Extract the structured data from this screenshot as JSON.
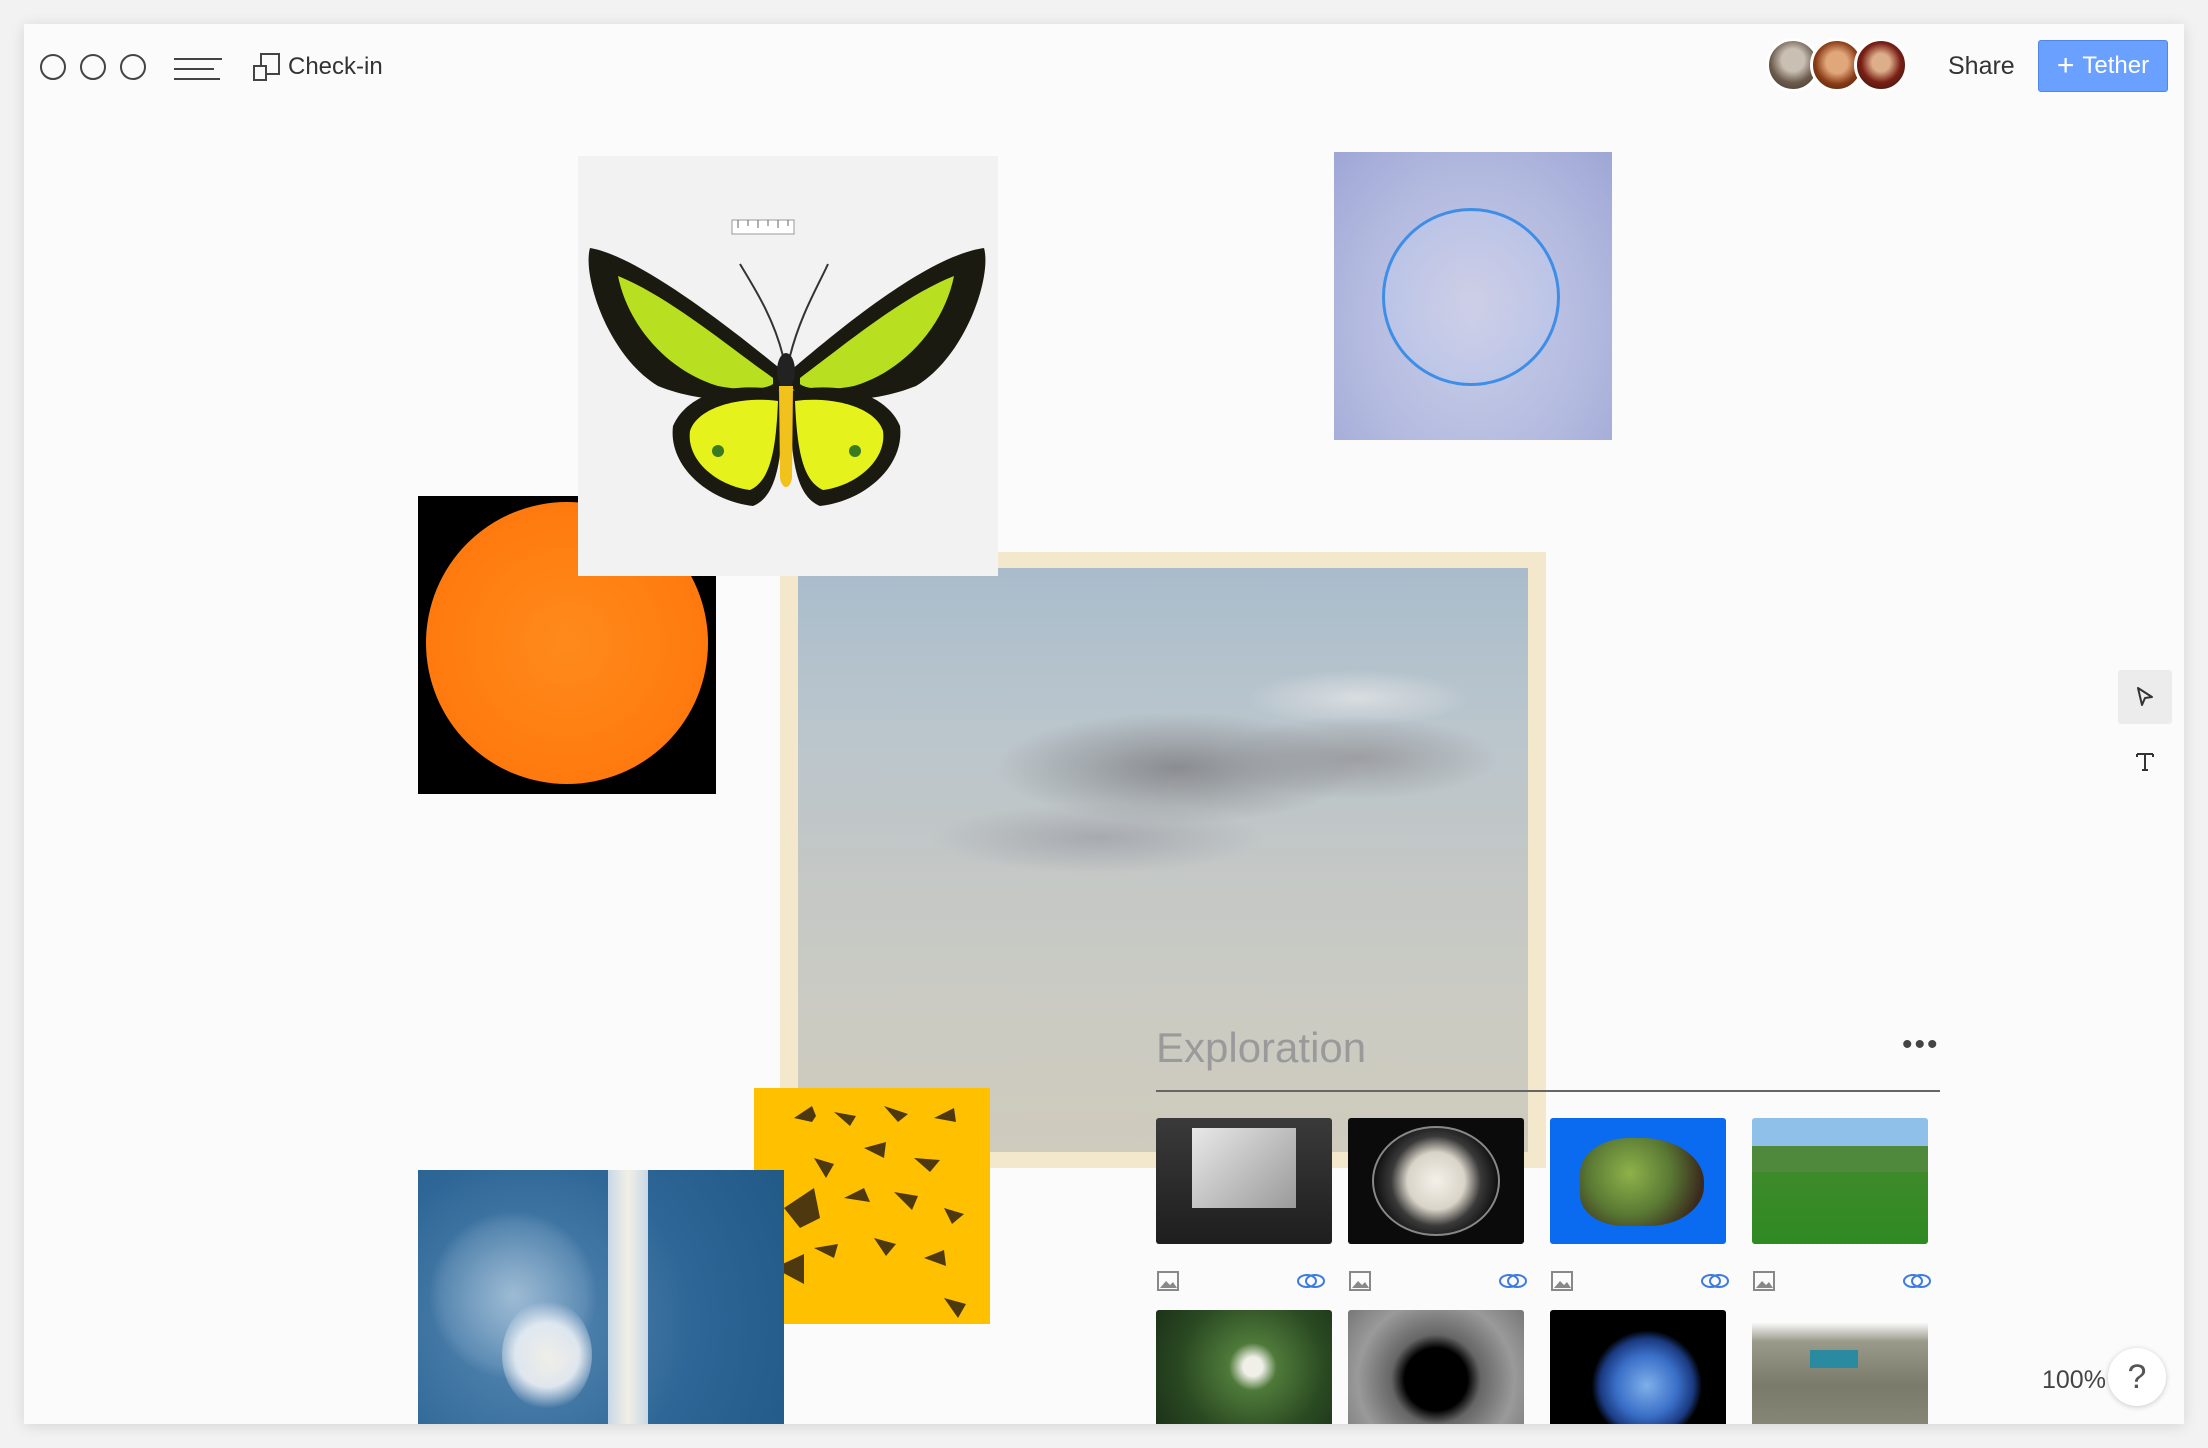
{
  "toolbar": {
    "doc_title": "Check-in",
    "share_label": "Share",
    "tether_label": "Tether",
    "tether_icon": "+",
    "accent_color": "#6aa0ff"
  },
  "board": {
    "images": [
      {
        "name": "butterfly-image",
        "label": "butterfly specimen"
      },
      {
        "name": "bubble-image",
        "label": "soap bubble"
      },
      {
        "name": "sun-image",
        "label": "orange sun"
      },
      {
        "name": "cloud-painting-image",
        "label": "watercolor clouds"
      },
      {
        "name": "moths-image",
        "label": "moths on yellow"
      },
      {
        "name": "cyanotype-image",
        "label": "dandelion cyanotype"
      }
    ]
  },
  "exploration": {
    "title": "Exploration",
    "more": "•••"
  },
  "footer": {
    "zoom": "100%",
    "help": "?"
  }
}
